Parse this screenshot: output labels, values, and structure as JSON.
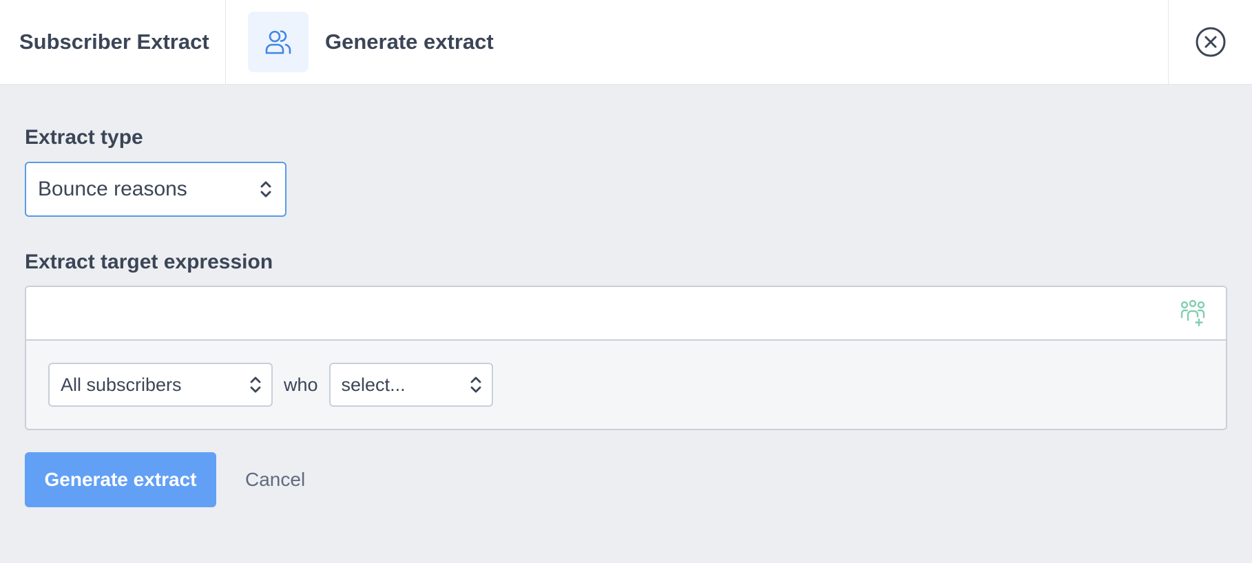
{
  "header": {
    "app_title": "Subscriber Extract",
    "page_title": "Generate extract",
    "icon": "users-icon",
    "close_icon": "close-circle-icon"
  },
  "form": {
    "extract_type": {
      "label": "Extract type",
      "selected": "Bounce reasons"
    },
    "target_expression": {
      "label": "Extract target expression",
      "input_value": "",
      "input_icon": "add-group-icon",
      "subject_select": "All subscribers",
      "connector": "who",
      "condition_select": "select..."
    }
  },
  "actions": {
    "primary_label": "Generate extract",
    "cancel_label": "Cancel"
  },
  "colors": {
    "accent": "#62a0f5",
    "focus_border": "#5a9ae6",
    "icon_blue": "#3f86e6",
    "icon_green": "#7fcfae",
    "background": "#eceef2"
  }
}
